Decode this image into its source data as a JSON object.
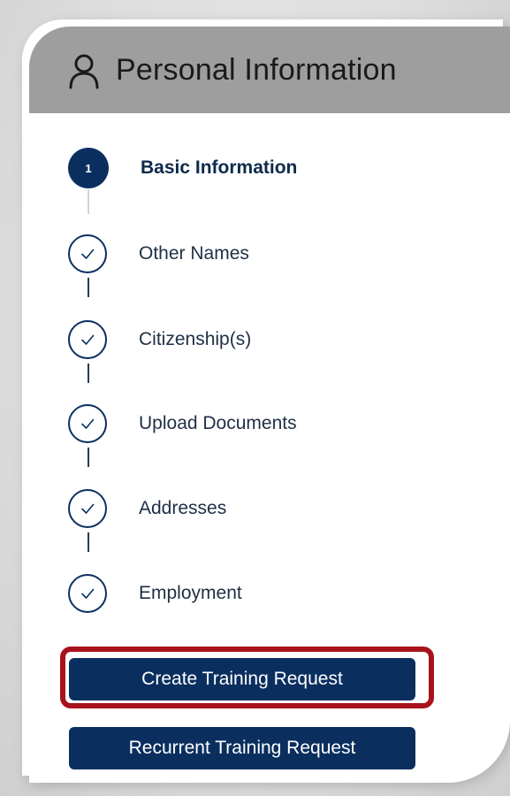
{
  "header": {
    "title": "Personal Information",
    "icon": "person-icon"
  },
  "steps": [
    {
      "number": "1",
      "label": "Basic Information",
      "status": "active"
    },
    {
      "label": "Other Names",
      "status": "completed"
    },
    {
      "label": "Citizenship(s)",
      "status": "completed"
    },
    {
      "label": "Upload Documents",
      "status": "completed"
    },
    {
      "label": "Addresses",
      "status": "completed"
    },
    {
      "label": "Employment",
      "status": "completed"
    }
  ],
  "buttons": {
    "create_training_request": "Create Training Request",
    "recurrent_training_request": "Recurrent Training Request"
  },
  "colors": {
    "header_bg": "#9e9e9e",
    "primary": "#0a2f5f",
    "highlight": "#a8121c"
  }
}
